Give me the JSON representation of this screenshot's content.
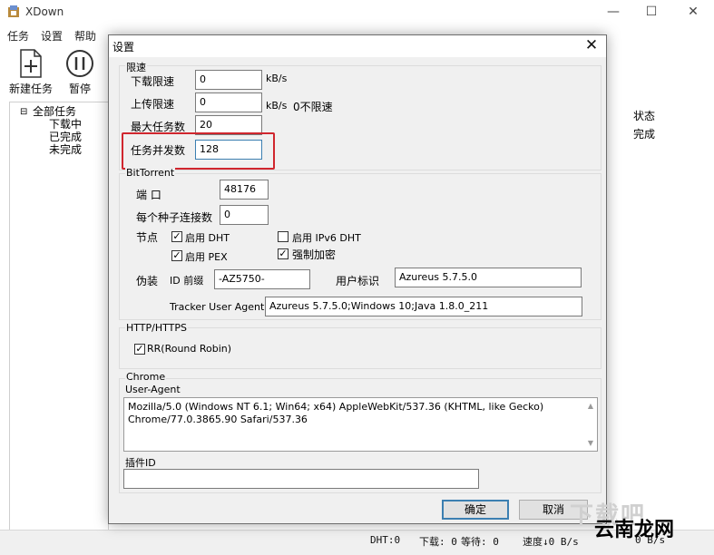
{
  "window": {
    "title": "XDown",
    "controls": {
      "minimize": "—",
      "maximize": "☐",
      "close": "✕"
    }
  },
  "menu": [
    "任务",
    "设置",
    "帮助"
  ],
  "toolbar": {
    "new_task": "新建任务",
    "pause": "暂停"
  },
  "tree": {
    "root": "全部任务",
    "items": [
      "下载中",
      "已完成",
      "未完成"
    ]
  },
  "list": {
    "status_header": "状态",
    "status_value": "完成"
  },
  "statusbar": {
    "dht": "DHT:0",
    "download": "下载: 0",
    "waiting": "等待: 0",
    "speed": "速度↓0 B/s",
    "extra": "0 B/s"
  },
  "dialog": {
    "title": "设置",
    "close": "✕",
    "speed": {
      "group": "限速",
      "download_label": "下载限速",
      "download_value": "0",
      "download_unit": "kB/s",
      "upload_label": "上传限速",
      "upload_value": "0",
      "upload_unit": "kB/s",
      "upload_hint": "0不限速",
      "max_tasks_label": "最大任务数",
      "max_tasks_value": "20",
      "concurrency_label": "任务并发数",
      "concurrency_value": "128"
    },
    "bittorrent": {
      "group": "BitTorrent",
      "port_label": "端 口",
      "port_value": "48176",
      "conn_label": "每个种子连接数",
      "conn_value": "0",
      "node_label": "节点",
      "dht": {
        "label": "启用 DHT",
        "checked": true
      },
      "ipv6": {
        "label": "启用 IPv6 DHT",
        "checked": false
      },
      "pex": {
        "label": "启用 PEX",
        "checked": true
      },
      "encrypt": {
        "label": "强制加密",
        "checked": true
      },
      "disguise_label": "伪装",
      "id_prefix_label": "ID 前缀",
      "id_prefix_value": "-AZ5750-",
      "user_id_label": "用户标识",
      "user_id_value": "Azureus 5.7.5.0",
      "tracker_ua_label": "Tracker User Agent",
      "tracker_ua_value": "Azureus 5.7.5.0;Windows 10;Java 1.8.0_211"
    },
    "http": {
      "group": "HTTP/HTTPS",
      "rr": {
        "label": "RR(Round Robin)",
        "checked": true
      }
    },
    "chrome": {
      "group": "Chrome",
      "ua_label": "User-Agent",
      "ua_line1": "Mozilla/5.0 (Windows NT 6.1; Win64; x64) AppleWebKit/537.36 (KHTML, like Gecko)",
      "ua_line2": "Chrome/77.0.3865.90 Safari/537.36",
      "plugin_label": "插件ID",
      "plugin_value": ""
    },
    "ok": "确定",
    "cancel": "取消"
  },
  "watermark": {
    "text1": "下载吧",
    "text2": "云南龙网"
  }
}
